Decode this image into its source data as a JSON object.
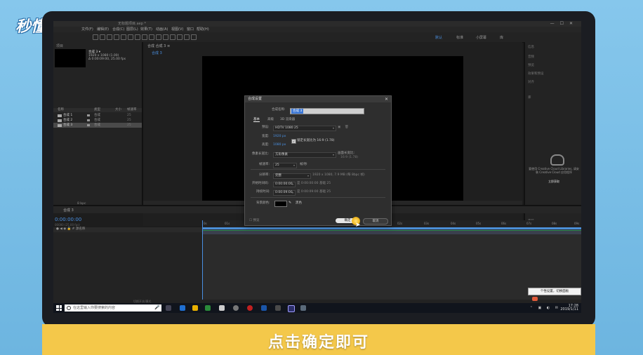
{
  "logo": {
    "text": "秒懂视频"
  },
  "caption": "点击确定即可",
  "app": {
    "title": "无标题项目.aep *",
    "menu": [
      "文件(F)",
      "编辑(E)",
      "合成(C)",
      "图层(L)",
      "效果(T)",
      "动画(A)",
      "视图(V)",
      "窗口",
      "帮助(H)"
    ],
    "workspaces": [
      {
        "label": "默认",
        "active": true
      },
      {
        "label": "标准",
        "active": false
      },
      {
        "label": "小屏幕",
        "active": false
      },
      {
        "label": "库",
        "active": false
      }
    ]
  },
  "project": {
    "tab": "项目",
    "comp_name": "合成 3 ▾",
    "comp_size": "1920 x 1080 (1.00)",
    "comp_duration": "Δ 0:00:09:00, 25.00 fps",
    "columns": [
      "名称",
      "类型",
      "大小",
      "帧速率"
    ],
    "rows": [
      {
        "name": "合成 1",
        "type": "合成",
        "size": "25"
      },
      {
        "name": "合成 2",
        "type": "合成",
        "size": "25"
      },
      {
        "name": "合成 3",
        "type": "合成",
        "size": "25"
      }
    ],
    "footer": "8 bpc"
  },
  "viewer": {
    "tab": "合成 合成 3 ≡",
    "sub_tab": "合成 3"
  },
  "right_panel": {
    "items": [
      "信息",
      "音频",
      "预览",
      "效果和预设",
      "对齐",
      "库",
      "字符"
    ],
    "cc_text": "要使用 Creative Cloud Libraries, 请安装 Creative Cloud 应用程序",
    "cc_link": "立即获取"
  },
  "timeline": {
    "tab": "合成 3",
    "timecode": "0:00:00:00",
    "timecode_sub": "00000 (25.00 fps)",
    "columns": "● ◀ ◉ 🔒   #   源名称",
    "ticks": [
      "0s",
      "01s",
      "02s",
      "03s",
      "04s",
      "05s",
      "06s",
      "07s",
      "08s",
      "09s"
    ],
    "footer": "切换开关/模式"
  },
  "taskbar": {
    "search_placeholder": "在这里输入你要搜索的内容",
    "time": "17:28",
    "date": "2019/1/11",
    "tooltip": "个性设置，切换面板"
  },
  "dialog": {
    "title": "合成设置",
    "name_label": "合成名称:",
    "name_value": "合成 3",
    "tabs": [
      "基本",
      "高级",
      "3D 渲染器"
    ],
    "preset_label": "预设:",
    "preset_value": "HDTV 1080 25",
    "width_label": "宽度:",
    "width_value": "1920 px",
    "lock_label": "锁定长宽比为 16:9 (1.78)",
    "height_label": "高度:",
    "height_value": "1080 px",
    "par_label": "像素长宽比:",
    "par_value": "方形像素",
    "frame_aspect_label": "画面长宽比:",
    "frame_aspect_value": "16:9 (1.78)",
    "fps_label": "帧速率:",
    "fps_value": "25",
    "fps_unit": "帧/秒",
    "res_label": "分辨率:",
    "res_value": "完整",
    "res_info": "1920 x 1080, 7.9 MB (每 8bpc 帧)",
    "start_label": "开始时间码:",
    "start_value": "0:00:00:00",
    "start_info": "是 0:00:00:00 基础 25",
    "dur_label": "持续时间:",
    "dur_value": "0:00:09:00",
    "dur_info": "是 0:00:09:00 基础 25",
    "bg_label": "背景颜色:",
    "bg_color": "#000000",
    "bg_name": "黑色",
    "preview_label": "预览",
    "ok": "确定",
    "cancel": "取消"
  }
}
